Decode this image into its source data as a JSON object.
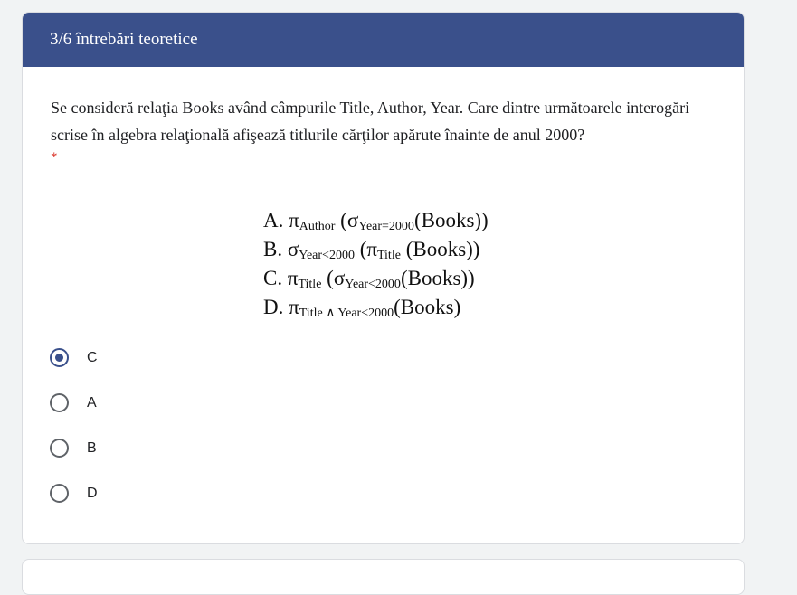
{
  "section": {
    "title": "3/6 întrebări teoretice"
  },
  "question": {
    "text": "Se consideră relaţia Books având câmpurile Title, Author, Year. Care dintre următoarele interogări scrise în algebra relaţională afişează titlurile cărţilor apărute înainte de anul 2000?",
    "required_marker": "*"
  },
  "formula_image": {
    "lines": [
      {
        "letter": "A.",
        "op1": "π",
        "sub1": "Author",
        "mid": " (σ",
        "sub2": "Year=2000",
        "rest": "(Books))"
      },
      {
        "letter": "B.",
        "op1": "σ",
        "sub1": "Year<2000",
        "mid": " (π",
        "sub2": "Title",
        "rest": " (Books))"
      },
      {
        "letter": "C.",
        "op1": "π",
        "sub1": "Title",
        "mid": " (σ",
        "sub2": "Year<2000",
        "rest": "(Books))"
      },
      {
        "letter": "D.",
        "op1": "π",
        "sub1": "Title ∧ Year<2000",
        "mid": "",
        "sub2": "",
        "rest": "(Books)"
      }
    ]
  },
  "options": [
    {
      "label": "C",
      "selected": true
    },
    {
      "label": "A",
      "selected": false
    },
    {
      "label": "B",
      "selected": false
    },
    {
      "label": "D",
      "selected": false
    }
  ],
  "colors": {
    "header": "#3a508b",
    "accent": "#3a508b",
    "required": "#d93025"
  }
}
